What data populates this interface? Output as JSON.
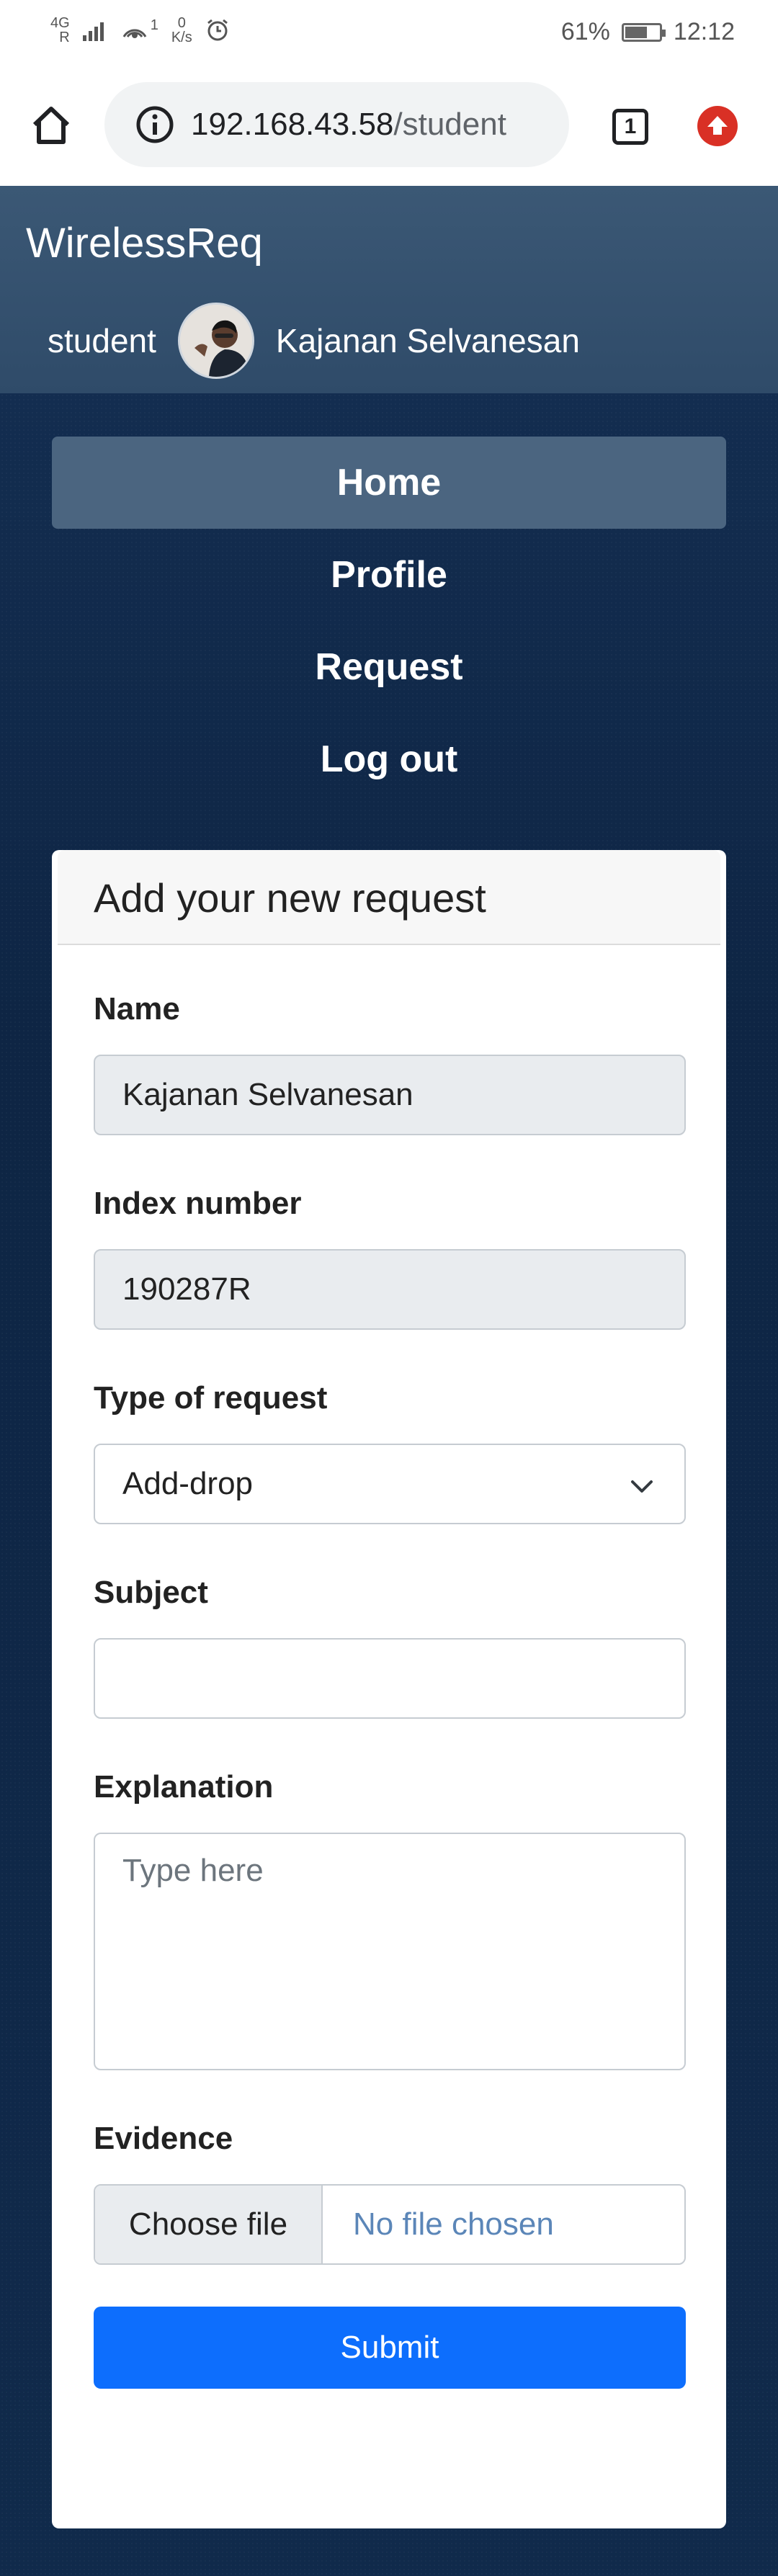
{
  "status_bar": {
    "network_top": "4G",
    "network_sub": "R",
    "data_rate_value": "0",
    "data_rate_unit": "K/s",
    "hotspot_count": "1",
    "battery": "61%",
    "time": "12:12",
    "icons": [
      "signal-icon",
      "hotspot-icon",
      "alarm-icon",
      "battery-icon"
    ]
  },
  "browser": {
    "url_host": "192.168.43.58",
    "url_path": "/student",
    "tab_count": "1",
    "icons": [
      "home-icon",
      "info-icon",
      "tabs-icon",
      "update-icon"
    ]
  },
  "header": {
    "brand": "WirelessReq",
    "role": "student",
    "user_name": "Kajanan Selvanesan"
  },
  "nav": {
    "items": [
      {
        "label": "Home",
        "active": true
      },
      {
        "label": "Profile",
        "active": false
      },
      {
        "label": "Request",
        "active": false
      },
      {
        "label": "Log out",
        "active": false
      }
    ]
  },
  "form": {
    "title": "Add your new request",
    "name_label": "Name",
    "name_value": "Kajanan Selvanesan",
    "index_label": "Index number",
    "index_value": "190287R",
    "type_label": "Type of request",
    "type_value": "Add-drop",
    "subject_label": "Subject",
    "subject_value": "",
    "explanation_label": "Explanation",
    "explanation_placeholder": "Type here",
    "evidence_label": "Evidence",
    "file_button": "Choose file",
    "file_status": "No file chosen",
    "submit_label": "Submit"
  },
  "colors": {
    "page_bg": "#0f2747",
    "header_bg": "#3b5875",
    "active_nav": "#4b6580",
    "submit": "#0d6efd",
    "update_icon": "#d93025"
  }
}
